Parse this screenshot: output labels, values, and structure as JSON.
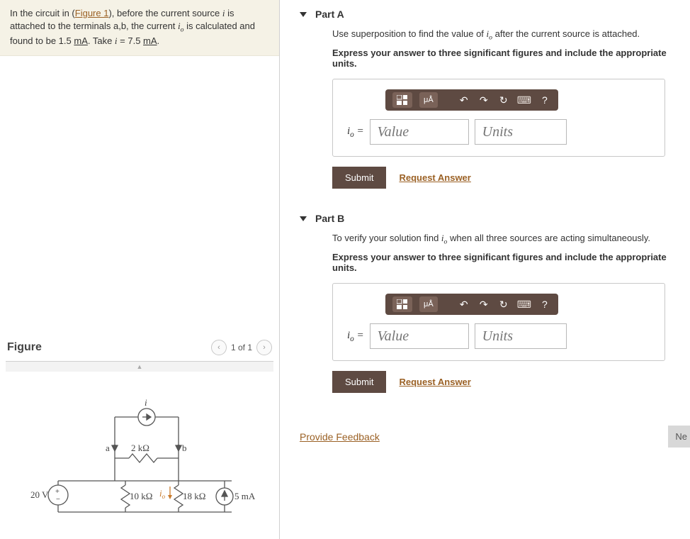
{
  "problem": {
    "pre_link": "In the circuit in (",
    "figure_link": "Figure 1",
    "post_link": "), before the current source ",
    "var_i": "i",
    "mid1": " is attached to the terminals a,b, the current ",
    "var_io": "i",
    "var_io_sub": "o",
    "mid2": " is calculated and found to be 1.5 ",
    "unit_ma": "mA",
    "mid3": ". Take ",
    "eq": " = 7.5 ",
    "period": "."
  },
  "figure": {
    "title": "Figure",
    "counter": "1 of 1",
    "labels": {
      "i": "i",
      "a": "a",
      "b": "b",
      "r2k": "2 kΩ",
      "r10k": "10 kΩ",
      "r18k": "18 kΩ",
      "io": "i",
      "io_sub": "o",
      "v20": "20 V",
      "i5ma": "5 mA"
    }
  },
  "parts": {
    "a": {
      "title": "Part A",
      "prompt_pre": "Use superposition to find the value of ",
      "prompt_post": " after the current source is attached.",
      "instruction": "Express your answer to three significant figures and include the appropriate units.",
      "toolbar_unit": "μÅ",
      "io_eq": " = ",
      "value_ph": "Value",
      "units_ph": "Units",
      "submit": "Submit",
      "request": "Request Answer"
    },
    "b": {
      "title": "Part B",
      "prompt_pre": "To verify your solution find ",
      "prompt_post": " when all three sources are acting simultaneously.",
      "instruction": "Express your answer to three significant figures and include the appropriate units.",
      "toolbar_unit": "μÅ",
      "io_eq": " = ",
      "value_ph": "Value",
      "units_ph": "Units",
      "submit": "Submit",
      "request": "Request Answer"
    }
  },
  "feedback": "Provide Feedback",
  "next_stub": "Ne"
}
